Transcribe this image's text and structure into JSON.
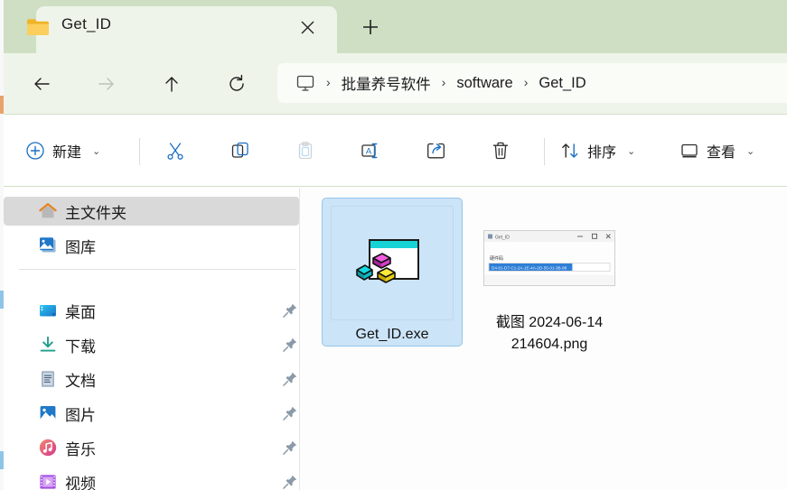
{
  "window": {
    "tab": {
      "title": "Get_ID",
      "folder_icon": "folder-icon",
      "close_icon": "close-icon"
    },
    "new_tab_icon": "plus-icon"
  },
  "nav": {
    "back": {
      "label": "后退",
      "icon": "arrow-left-icon",
      "enabled": true
    },
    "forward": {
      "label": "前进",
      "icon": "arrow-right-icon",
      "enabled": false
    },
    "up": {
      "label": "向上",
      "icon": "arrow-up-icon",
      "enabled": true
    },
    "refresh": {
      "label": "刷新",
      "icon": "refresh-icon",
      "enabled": true
    },
    "address": {
      "root_icon": "monitor-icon",
      "separator": "›",
      "crumbs": [
        "批量养号软件",
        "software",
        "Get_ID"
      ]
    }
  },
  "toolbar": {
    "new_label": "新建",
    "new_icon": "plus-circle-icon",
    "cut_icon": "scissors-icon",
    "copy_icon": "copy-icon",
    "paste_icon": "clipboard-icon",
    "rename_icon": "rename-icon",
    "share_icon": "share-icon",
    "delete_icon": "trash-icon",
    "sort_label": "排序",
    "sort_icon": "sort-arrows-icon",
    "view_label": "查看",
    "view_icon": "monitor-icon",
    "chevron": "⌄"
  },
  "sidebar": {
    "items": [
      {
        "label": "主文件夹",
        "icon": "home-icon",
        "selected": true,
        "pinned": false
      },
      {
        "label": "图库",
        "icon": "gallery-icon",
        "selected": false,
        "pinned": false
      },
      {
        "label": "桌面",
        "icon": "desktop-icon",
        "selected": false,
        "pinned": true
      },
      {
        "label": "下载",
        "icon": "download-icon",
        "selected": false,
        "pinned": true
      },
      {
        "label": "文档",
        "icon": "document-icon",
        "selected": false,
        "pinned": true
      },
      {
        "label": "图片",
        "icon": "pictures-icon",
        "selected": false,
        "pinned": true
      },
      {
        "label": "音乐",
        "icon": "music-icon",
        "selected": false,
        "pinned": true
      },
      {
        "label": "视频",
        "icon": "video-icon",
        "selected": false,
        "pinned": true
      }
    ],
    "pin_icon": "pin-icon"
  },
  "content": {
    "files": [
      {
        "name": "Get_ID.exe",
        "icon": "exe-window-icon",
        "selected": true
      },
      {
        "name": "截图 2024-06-14 214604.png",
        "icon": "png-thumbnail",
        "selected": false
      }
    ],
    "thumbnail": {
      "title": "Get_ID",
      "minimize": "—",
      "maximize": "▢",
      "close": "✕",
      "field_label": "硬件码",
      "field_value": "D4-81-D7-C1-2A-1E-4A-2D-55-01-3B-88"
    }
  },
  "colors": {
    "tabstrip": "#cfdfc3",
    "tab": "#eef4ea",
    "navbar": "#eef4ea",
    "accent_blue": "#0f6cbd",
    "selection": "#cce4f7",
    "selection_border": "#93c6ec",
    "sidebar_selected": "#d9d9d9"
  }
}
